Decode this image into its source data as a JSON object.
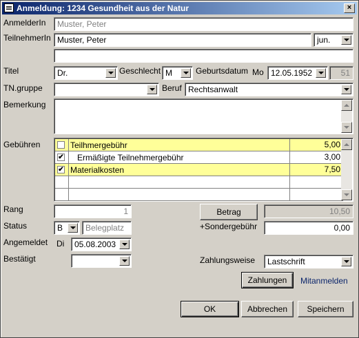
{
  "window": {
    "title": "Anmeldung: 1234 Gesundheit aus der Natur",
    "close": "×"
  },
  "labels": {
    "anmelder": "AnmelderIn",
    "teilnehmer": "TeilnehmerIn",
    "titel": "Titel",
    "geschlecht": "Geschlecht",
    "geburtsdatum": "Geburtsdatum",
    "wochentag": "Mo",
    "tngruppe": "TN.gruppe",
    "beruf": "Beruf",
    "bemerkung": "Bemerkung",
    "gebuehren": "Gebühren",
    "rang": "Rang",
    "status": "Status",
    "angemeldet": "Angemeldet",
    "angemeldet_tag": "Di",
    "bestaetigt": "Bestätigt",
    "sondergebuehr": "+Sondergebühr",
    "zahlungsweise": "Zahlungsweise"
  },
  "fields": {
    "anmelder_value": "Muster, Peter",
    "teilnehmer_value": "Muster, Peter",
    "suffix_value": "jun.",
    "teilnehmer_zusatz": "",
    "titel_value": "Dr.",
    "geschlecht_value": "M",
    "geburtsdatum_value": "12.05.1952",
    "alter_value": "51",
    "tngruppe_value": "",
    "beruf_value": "Rechtsanwalt",
    "bemerkung_value": "",
    "rang_value": "1",
    "status_value": "B",
    "status_text": "Belegplatz",
    "angemeldet_value": "05.08.2003",
    "bestaetigt_value": "",
    "betrag_value": "10,50",
    "sondergebuehr_value": "0,00",
    "zahlungsweise_value": "Lastschrift"
  },
  "fees": [
    {
      "label": "Teilhmergebühr",
      "value": "5,00",
      "checked": false,
      "highlight": true,
      "indent": false
    },
    {
      "label": "Ermäßigte Teilnehmergebühr",
      "value": "3,00",
      "checked": true,
      "highlight": false,
      "indent": true
    },
    {
      "label": "Materialkosten",
      "value": "7,50",
      "checked": true,
      "highlight": true,
      "indent": false
    }
  ],
  "buttons": {
    "betrag": "Betrag",
    "zahlungen": "Zahlungen",
    "mitanmelden": "Mitanmelden",
    "ok": "OK",
    "abbrechen": "Abbrechen",
    "speichern": "Speichern"
  }
}
